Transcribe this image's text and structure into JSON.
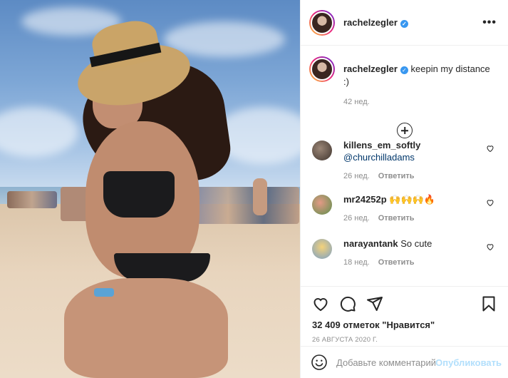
{
  "post": {
    "username": "rachelzegler",
    "caption_text": "keepin my distance :)",
    "caption_time": "42 нед.",
    "likes_text": "32 409 отметок \"Нравится\"",
    "date_text": "26 АВГУСТА 2020 Г.",
    "more_label": "•••"
  },
  "comments": [
    {
      "username": "killens_em_softly",
      "text": "@churchilladams",
      "time": "26 нед.",
      "reply": "Ответить",
      "avatar_color": "#6a5a4e"
    },
    {
      "username": "mr24252p",
      "text": "🙌🙌🙌🔥",
      "time": "26 нед.",
      "reply": "Ответить",
      "avatar_color": "#c0504a"
    },
    {
      "username": "narayantank",
      "text": "So cute",
      "time": "18 нед.",
      "reply": "Ответить",
      "avatar_color": "#e4b83a"
    }
  ],
  "add_comment": {
    "placeholder": "Добавьте комментарий...",
    "post_label": "Опубликовать"
  },
  "colors": {
    "verified": "#3897f0",
    "link": "#00376b",
    "post_button_disabled": "#b2dffc"
  },
  "icons": [
    "heart-icon",
    "comment-icon",
    "share-icon",
    "bookmark-icon",
    "emoji-icon",
    "plus-circle-icon",
    "verified-icon",
    "more-icon"
  ]
}
